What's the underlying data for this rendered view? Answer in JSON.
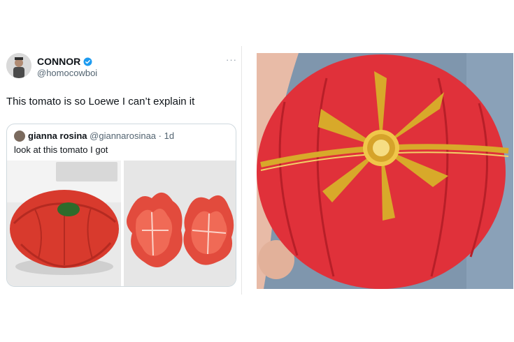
{
  "tweet": {
    "name": "CONNOR",
    "handle": "@homocowboi",
    "more": "···",
    "text": "This tomato is so Loewe I can’t explain it"
  },
  "quote": {
    "name": "gianna rosina",
    "handle": "@giannarosinaa",
    "separator": " · ",
    "time": "1d",
    "text": "look at this tomato I got"
  },
  "icons": {
    "verified": "verified-badge-icon",
    "more": "more-options-icon"
  },
  "colors": {
    "verified_blue": "#1d9bf0",
    "tomato_red": "#e0313a",
    "gold": "#d8a92a"
  }
}
